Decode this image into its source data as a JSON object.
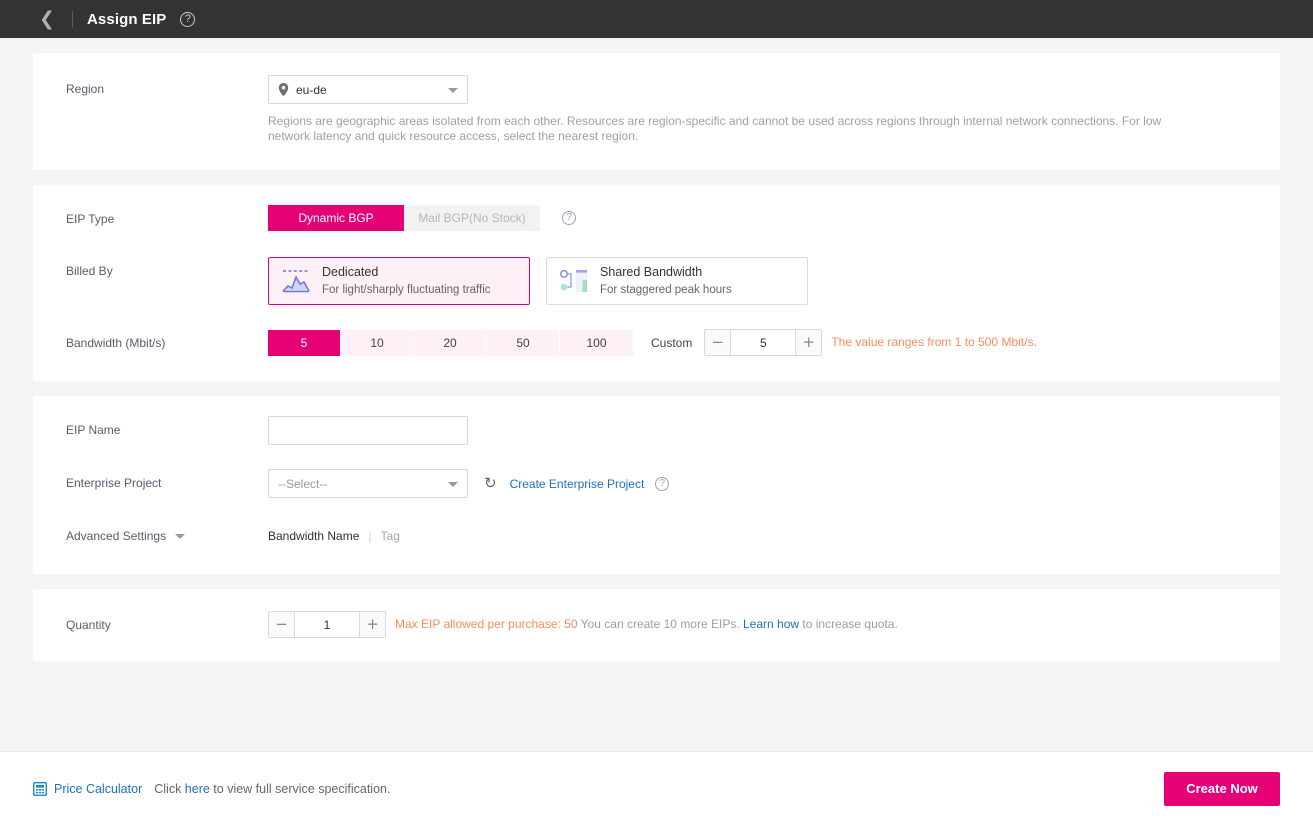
{
  "header": {
    "back_icon": "chevron-left-icon",
    "title": "Assign EIP",
    "help_icon": "?"
  },
  "region": {
    "label": "Region",
    "value": "eu-de",
    "pin_icon": "location-pin-icon",
    "description": "Regions are geographic areas isolated from each other. Resources are region-specific and cannot be used across regions through internal network connections. For low network latency and quick resource access, select the nearest region."
  },
  "eip_type": {
    "label": "EIP Type",
    "options": [
      {
        "label": "Dynamic BGP",
        "active": true
      },
      {
        "label": "Mail BGP(No Stock)",
        "active": false
      }
    ],
    "help_icon": "?"
  },
  "billed_by": {
    "label": "Billed By",
    "cards": [
      {
        "title": "Dedicated",
        "subtitle": "For light/sharply fluctuating traffic",
        "icon": "line-chart-icon",
        "selected": true
      },
      {
        "title": "Shared Bandwidth",
        "subtitle": "For staggered peak hours",
        "icon": "shared-bandwidth-icon",
        "selected": false
      }
    ]
  },
  "bandwidth": {
    "label": "Bandwidth (Mbit/s)",
    "presets": [
      "5",
      "10",
      "20",
      "50",
      "100"
    ],
    "active_preset": "5",
    "custom_label": "Custom",
    "custom_value": "5",
    "minus_icon": "minus-icon",
    "plus_icon": "plus-icon",
    "hint": "The value ranges from 1 to 500 Mbit/s.",
    "hint_color": "#fa8c58"
  },
  "eip_name": {
    "label": "EIP Name",
    "value": "",
    "placeholder": ""
  },
  "enterprise_project": {
    "label": "Enterprise Project",
    "selected": "--Select--",
    "refresh_icon": "refresh-icon",
    "create_link": "Create Enterprise Project",
    "help_icon": "?"
  },
  "advanced_settings": {
    "label": "Advanced Settings",
    "caret_icon": "chevron-down-icon",
    "links": [
      {
        "label": "Bandwidth Name",
        "muted": false
      },
      {
        "label": "Tag",
        "muted": true
      }
    ],
    "separator": "|"
  },
  "quantity": {
    "label": "Quantity",
    "value": "1",
    "minus_icon": "minus-icon",
    "plus_icon": "plus-icon",
    "hint_orange": "Max EIP allowed per purchase: 50",
    "hint_grey_1": " You can create 10 more EIPs. ",
    "hint_link": "Learn how",
    "hint_grey_2": " to increase quota."
  },
  "footer": {
    "calculator_icon": "calculator-icon",
    "calculator_label": "Price Calculator",
    "note_prefix": "Click ",
    "note_link": "here",
    "note_suffix": " to view full service specification.",
    "create_button": "Create Now",
    "accent_color": "#e50076"
  }
}
